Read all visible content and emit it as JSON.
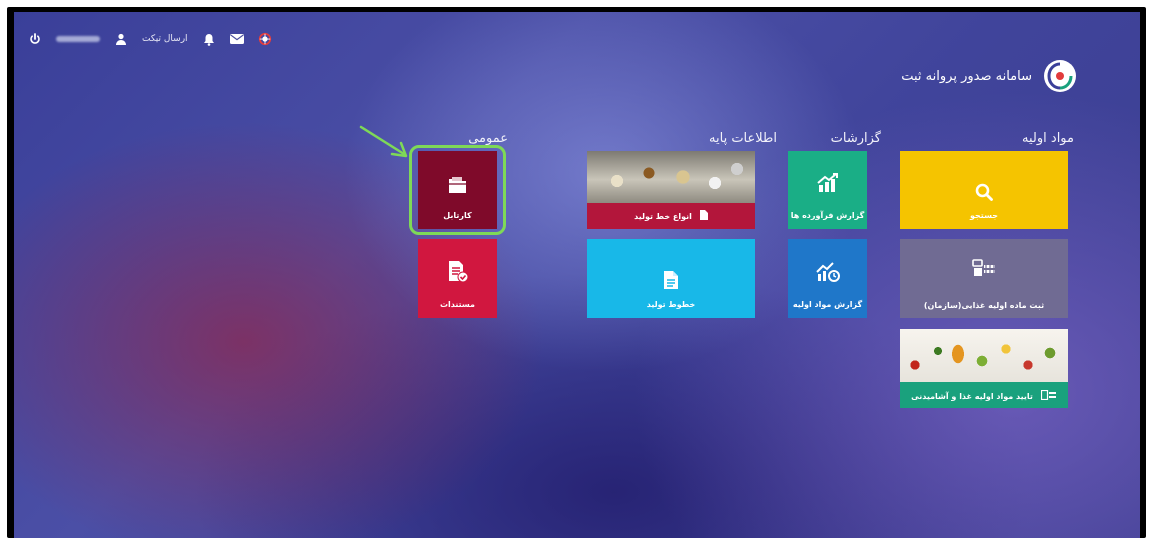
{
  "topbar": {
    "user_name_blurred": "",
    "send_ticket": "ارسال تیکت"
  },
  "brand": {
    "name": "سامانه صدور پروانه ثبت",
    "logo_icon": "brand-logo-icon"
  },
  "sections": {
    "raw_materials": "مواد اولیه",
    "reports": "گزارشات",
    "base_info": "اطلاعات پایه",
    "general": "عمومی"
  },
  "tiles": {
    "search": {
      "label": "جستجو",
      "color": "#f5c400",
      "icon": "search-icon"
    },
    "register_food_material": {
      "label": "ثبت ماده اولیه غذایی(سازمان)",
      "color": "#706b93",
      "icon": "food-material-icon"
    },
    "approve_material": {
      "label": "تایید مواد اولیه غذا و آشامیدنی",
      "color": "#1aa17d",
      "icon": "approve-material-icon"
    },
    "processed_report": {
      "label": "گزارش فرآورده ها",
      "color": "#1aae86",
      "icon": "chart-up-icon"
    },
    "raw_material_report": {
      "label": "گزارش مواد اولیه",
      "color": "#1f77c9",
      "icon": "chart-cycle-icon"
    },
    "production_line_types": {
      "label": "انواع خط تولید",
      "color": "#b3163b",
      "icon": "document-icon"
    },
    "production_lines": {
      "label": "خطوط تولید",
      "color": "#18b8e8",
      "icon": "document-icon"
    },
    "cartable": {
      "label": "کارتابل",
      "color": "#7f0a2a",
      "icon": "folder-icon"
    },
    "documents": {
      "label": "مستندات",
      "color": "#d1173f",
      "icon": "document-check-icon"
    }
  },
  "annotation": {
    "highlight_color": "#7ed957"
  }
}
